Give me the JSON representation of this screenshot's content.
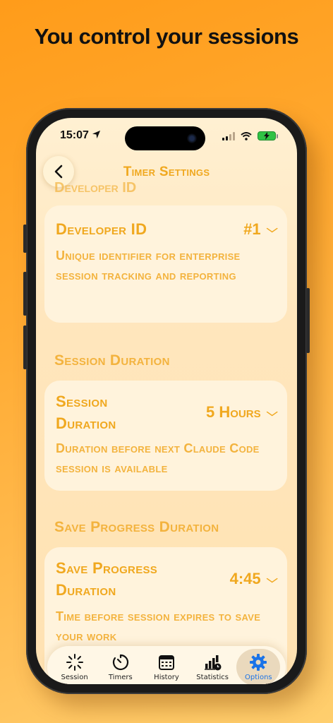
{
  "headline": "You control your sessions",
  "status_bar": {
    "time": "15:07"
  },
  "nav": {
    "title": "Timer Settings",
    "ghost_header": "Developer ID"
  },
  "sections": [
    {
      "header": "Developer ID",
      "label": "Developer ID",
      "value": "#1",
      "description": "Unique identifier for enterprise session tracking and reporting"
    },
    {
      "header": "Session Duration",
      "label": "Session Duration",
      "value": "5 Hours",
      "description": "Duration before next Claude Code session is available"
    },
    {
      "header": "Save Progress Duration",
      "label": "Save Progress Duration",
      "value": "4:45",
      "description": "Time before session expires to save your work"
    }
  ],
  "tabs": [
    {
      "label": "Session",
      "icon": "loader-icon"
    },
    {
      "label": "Timers",
      "icon": "timer-icon"
    },
    {
      "label": "History",
      "icon": "calendar-icon"
    },
    {
      "label": "Statistics",
      "icon": "chart-clock-icon"
    },
    {
      "label": "Options",
      "icon": "gear-icon"
    }
  ],
  "colors": {
    "accent": "#f0a81f",
    "active_tab": "#1a73e8"
  }
}
